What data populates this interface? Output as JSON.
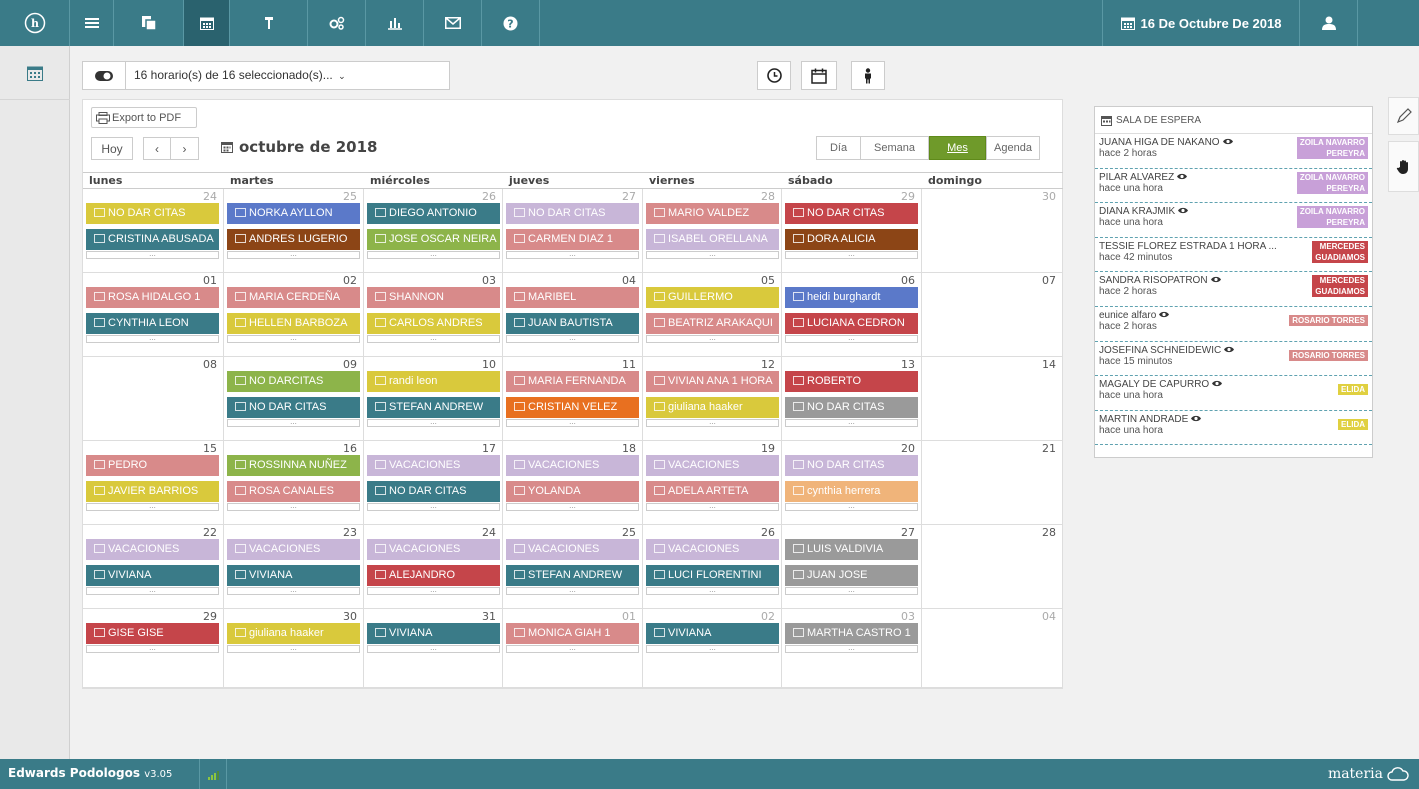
{
  "nav": {
    "icons": [
      "logo-h-icon",
      "menu-icon",
      "copy-icon",
      "calendar-icon",
      "podiatry-icon",
      "settings-icon",
      "chart-icon",
      "mail-icon",
      "help-icon"
    ],
    "date_label": "16 De Octubre De 2018",
    "user_icon": "user-icon"
  },
  "toolbar": {
    "schedules_label": "16 horario(s) de 16 seleccionado(s)..."
  },
  "calendar": {
    "export_label": "Export to PDF",
    "today_label": "Hoy",
    "prev_label": "‹",
    "next_label": "›",
    "title": "octubre de 2018",
    "views": [
      "Día",
      "Semana",
      "Mes",
      "Agenda"
    ],
    "active_view": "Mes",
    "days": [
      "lunes",
      "martes",
      "miércoles",
      "jueves",
      "viernes",
      "sábado",
      "domingo"
    ],
    "more_label": "...",
    "weeks": [
      {
        "cells": [
          {
            "n": "24",
            "other": true,
            "events": [
              {
                "t": "NO DAR CITAS",
                "c": "#d9c93c",
                "i": "cal"
              },
              {
                "t": "CRISTINA ABUSADA",
                "c": "#3a7b88",
                "i": "copy"
              }
            ]
          },
          {
            "n": "25",
            "other": true,
            "events": [
              {
                "t": "NORKA AYLLON",
                "c": "#5b79c9",
                "i": "card"
              },
              {
                "t": "ANDRES LUGERIO",
                "c": "#8c4516",
                "i": "copy"
              }
            ]
          },
          {
            "n": "26",
            "other": true,
            "events": [
              {
                "t": "DIEGO ANTONIO",
                "c": "#3a7b88",
                "i": "copy"
              },
              {
                "t": "JOSE OSCAR NEIRA",
                "c": "#8db44a",
                "i": "card"
              }
            ]
          },
          {
            "n": "27",
            "other": true,
            "events": [
              {
                "t": "NO DAR CITAS",
                "c": "#c8b6d8",
                "i": "cal"
              },
              {
                "t": "CARMEN DIAZ 1",
                "c": "#d88a8a",
                "i": "card"
              }
            ]
          },
          {
            "n": "28",
            "other": true,
            "events": [
              {
                "t": "MARIO VALDEZ",
                "c": "#d88a8a",
                "i": "card"
              },
              {
                "t": "ISABEL ORELLANA",
                "c": "#c8b6d8",
                "i": "card"
              }
            ]
          },
          {
            "n": "29",
            "other": true,
            "events": [
              {
                "t": "NO DAR CITAS",
                "c": "#c5454a",
                "i": "cal"
              },
              {
                "t": "DORA ALICIA",
                "c": "#8c4516",
                "i": "copy"
              }
            ]
          },
          {
            "n": "30",
            "other": true,
            "events": []
          }
        ]
      },
      {
        "cells": [
          {
            "n": "01",
            "other": false,
            "events": [
              {
                "t": "ROSA HIDALGO 1",
                "c": "#d88a8a",
                "i": "card"
              },
              {
                "t": "CYNTHIA LEON",
                "c": "#3a7b88",
                "i": "copy"
              }
            ]
          },
          {
            "n": "02",
            "other": false,
            "events": [
              {
                "t": "MARIA CERDEÑA",
                "c": "#d88a8a",
                "i": "card"
              },
              {
                "t": "HELLEN BARBOZA",
                "c": "#d9c93c",
                "i": "card"
              }
            ]
          },
          {
            "n": "03",
            "other": false,
            "events": [
              {
                "t": "SHANNON",
                "c": "#d88a8a",
                "i": "card"
              },
              {
                "t": "CARLOS ANDRES",
                "c": "#d9c93c",
                "i": "card"
              }
            ]
          },
          {
            "n": "04",
            "other": false,
            "events": [
              {
                "t": "MARIBEL",
                "c": "#d88a8a",
                "i": "card"
              },
              {
                "t": "JUAN BAUTISTA",
                "c": "#3a7b88",
                "i": "copy"
              }
            ]
          },
          {
            "n": "05",
            "other": false,
            "events": [
              {
                "t": "GUILLERMO",
                "c": "#d9c93c",
                "i": "card"
              },
              {
                "t": "BEATRIZ ARAKAQUI",
                "c": "#d88a8a",
                "i": "card"
              }
            ]
          },
          {
            "n": "06",
            "other": false,
            "events": [
              {
                "t": "heidi burghardt",
                "c": "#5b79c9",
                "i": "card"
              },
              {
                "t": "LUCIANA CEDRON",
                "c": "#c5454a",
                "i": "card"
              }
            ]
          },
          {
            "n": "07",
            "other": false,
            "events": []
          }
        ]
      },
      {
        "cells": [
          {
            "n": "08",
            "other": false,
            "events": []
          },
          {
            "n": "09",
            "other": false,
            "events": [
              {
                "t": "NO DARCITAS",
                "c": "#8db44a",
                "i": "cal"
              },
              {
                "t": "NO DAR CITAS",
                "c": "#3a7b88",
                "i": "cal"
              }
            ]
          },
          {
            "n": "10",
            "other": false,
            "events": [
              {
                "t": "randi leon",
                "c": "#d9c93c",
                "i": "card"
              },
              {
                "t": "STEFAN ANDREW",
                "c": "#3a7b88",
                "i": "card"
              }
            ]
          },
          {
            "n": "11",
            "other": false,
            "events": [
              {
                "t": "MARIA FERNANDA",
                "c": "#d88a8a",
                "i": "cal"
              },
              {
                "t": "CRISTIAN VELEZ",
                "c": "#e87020",
                "i": "copy"
              }
            ]
          },
          {
            "n": "12",
            "other": false,
            "events": [
              {
                "t": "VIVIAN ANA 1 HORA",
                "c": "#d88a8a",
                "i": "card"
              },
              {
                "t": "giuliana haaker",
                "c": "#d9c93c",
                "i": "copy"
              }
            ]
          },
          {
            "n": "13",
            "other": false,
            "events": [
              {
                "t": "ROBERTO",
                "c": "#c5454a",
                "i": "card"
              },
              {
                "t": "NO DAR CITAS",
                "c": "#9a9a9a",
                "i": "cal"
              }
            ]
          },
          {
            "n": "14",
            "other": false,
            "events": []
          }
        ]
      },
      {
        "cells": [
          {
            "n": "15",
            "other": false,
            "events": [
              {
                "t": "PEDRO",
                "c": "#d88a8a",
                "i": "card"
              },
              {
                "t": "JAVIER BARRIOS",
                "c": "#d9c93c",
                "i": "card"
              }
            ]
          },
          {
            "n": "16",
            "other": false,
            "events": [
              {
                "t": "ROSSINNA NUÑEZ",
                "c": "#8db44a",
                "i": "copy"
              },
              {
                "t": "ROSA CANALES",
                "c": "#d88a8a",
                "i": "card"
              }
            ]
          },
          {
            "n": "17",
            "other": false,
            "events": [
              {
                "t": "VACACIONES",
                "c": "#c8b6d8",
                "i": "cal"
              },
              {
                "t": "NO DAR CITAS",
                "c": "#3a7b88",
                "i": "cal"
              }
            ]
          },
          {
            "n": "18",
            "other": false,
            "events": [
              {
                "t": "VACACIONES",
                "c": "#c8b6d8",
                "i": "cal"
              },
              {
                "t": "YOLANDA",
                "c": "#d88a8a",
                "i": "cal"
              }
            ]
          },
          {
            "n": "19",
            "other": false,
            "events": [
              {
                "t": "VACACIONES",
                "c": "#c8b6d8",
                "i": "cal"
              },
              {
                "t": "ADELA ARTETA",
                "c": "#d88a8a",
                "i": "cal"
              }
            ]
          },
          {
            "n": "20",
            "other": false,
            "events": [
              {
                "t": "NO DAR CITAS",
                "c": "#c8b6d8",
                "i": "cal"
              },
              {
                "t": "cynthia herrera",
                "c": "#f0b47a",
                "i": "cal"
              }
            ]
          },
          {
            "n": "21",
            "other": false,
            "events": []
          }
        ]
      },
      {
        "cells": [
          {
            "n": "22",
            "other": false,
            "events": [
              {
                "t": "VACACIONES",
                "c": "#c8b6d8",
                "i": "cal"
              },
              {
                "t": "VIVIANA",
                "c": "#3a7b88",
                "i": "cal"
              }
            ]
          },
          {
            "n": "23",
            "other": false,
            "events": [
              {
                "t": "VACACIONES",
                "c": "#c8b6d8",
                "i": "cal"
              },
              {
                "t": "VIVIANA",
                "c": "#3a7b88",
                "i": "cal"
              }
            ]
          },
          {
            "n": "24",
            "other": false,
            "events": [
              {
                "t": "VACACIONES",
                "c": "#c8b6d8",
                "i": "cal"
              },
              {
                "t": "ALEJANDRO",
                "c": "#c5454a",
                "i": "cal"
              }
            ]
          },
          {
            "n": "25",
            "other": false,
            "events": [
              {
                "t": "VACACIONES",
                "c": "#c8b6d8",
                "i": "cal"
              },
              {
                "t": "STEFAN ANDREW",
                "c": "#3a7b88",
                "i": "cal"
              }
            ]
          },
          {
            "n": "26",
            "other": false,
            "events": [
              {
                "t": "VACACIONES",
                "c": "#c8b6d8",
                "i": "cal"
              },
              {
                "t": "LUCI FLORENTINI",
                "c": "#3a7b88",
                "i": "cal"
              }
            ]
          },
          {
            "n": "27",
            "other": false,
            "events": [
              {
                "t": "LUIS VALDIVIA",
                "c": "#9a9a9a",
                "i": "cal"
              },
              {
                "t": "JUAN JOSE",
                "c": "#9a9a9a",
                "i": "cal"
              }
            ]
          },
          {
            "n": "28",
            "other": false,
            "events": []
          }
        ]
      },
      {
        "cells": [
          {
            "n": "29",
            "other": false,
            "events": [
              {
                "t": "GISE GISE",
                "c": "#c5454a",
                "i": "cal"
              }
            ]
          },
          {
            "n": "30",
            "other": false,
            "events": [
              {
                "t": "giuliana haaker",
                "c": "#d9c93c",
                "i": "cal"
              }
            ]
          },
          {
            "n": "31",
            "other": false,
            "events": [
              {
                "t": "VIVIANA",
                "c": "#3a7b88",
                "i": "cal"
              }
            ]
          },
          {
            "n": "01",
            "other": true,
            "events": [
              {
                "t": "MONICA GIAH 1",
                "c": "#d88a8a",
                "i": "cal"
              }
            ]
          },
          {
            "n": "02",
            "other": true,
            "events": [
              {
                "t": "VIVIANA",
                "c": "#3a7b88",
                "i": "cal"
              }
            ]
          },
          {
            "n": "03",
            "other": true,
            "events": [
              {
                "t": "MARTHA CASTRO 1",
                "c": "#9a9a9a",
                "i": "cal"
              }
            ]
          },
          {
            "n": "04",
            "other": true,
            "events": []
          }
        ]
      }
    ]
  },
  "waiting_room": {
    "title": "SALA DE ESPERA",
    "patients": [
      {
        "name": "JUANA HIGA DE NAKANO",
        "eye": true,
        "time": "hace 2 horas",
        "badge": [
          "ZOILA NAVARRO",
          "PEREYRA"
        ],
        "color": "#c8a0d8"
      },
      {
        "name": "PILAR ALVAREZ",
        "eye": true,
        "time": "hace una hora",
        "badge": [
          "ZOILA NAVARRO",
          "PEREYRA"
        ],
        "color": "#c8a0d8"
      },
      {
        "name": "DIANA KRAJMIK",
        "eye": true,
        "time": "hace una hora",
        "badge": [
          "ZOILA NAVARRO",
          "PEREYRA"
        ],
        "color": "#c8a0d8"
      },
      {
        "name": "TESSIE FLOREZ ESTRADA 1 HORA ...",
        "eye": false,
        "time": "hace 42 minutos",
        "badge": [
          "MERCEDES",
          "GUADIAMOS"
        ],
        "color": "#c5454a"
      },
      {
        "name": "SANDRA RISOPATRON",
        "eye": true,
        "time": "hace 2 horas",
        "badge": [
          "MERCEDES",
          "GUADIAMOS"
        ],
        "color": "#c5454a"
      },
      {
        "name": "eunice alfaro",
        "eye": true,
        "time": "hace 2 horas",
        "badge": [
          "ROSARIO TORRES"
        ],
        "color": "#d88a8a"
      },
      {
        "name": "JOSEFINA SCHNEIDEWIC",
        "eye": true,
        "time": "hace 15 minutos",
        "badge": [
          "ROSARIO TORRES"
        ],
        "color": "#d88a8a"
      },
      {
        "name": "MAGALY DE CAPURRO",
        "eye": true,
        "time": "hace una hora",
        "badge": [
          "ELIDA"
        ],
        "color": "#e0d040"
      },
      {
        "name": "MARTIN ANDRADE",
        "eye": true,
        "time": "hace una hora",
        "badge": [
          "ELIDA"
        ],
        "color": "#e0d040"
      }
    ]
  },
  "footer": {
    "app_name": "Edwards Podologos",
    "version": "v3.05",
    "brand": "materia"
  }
}
